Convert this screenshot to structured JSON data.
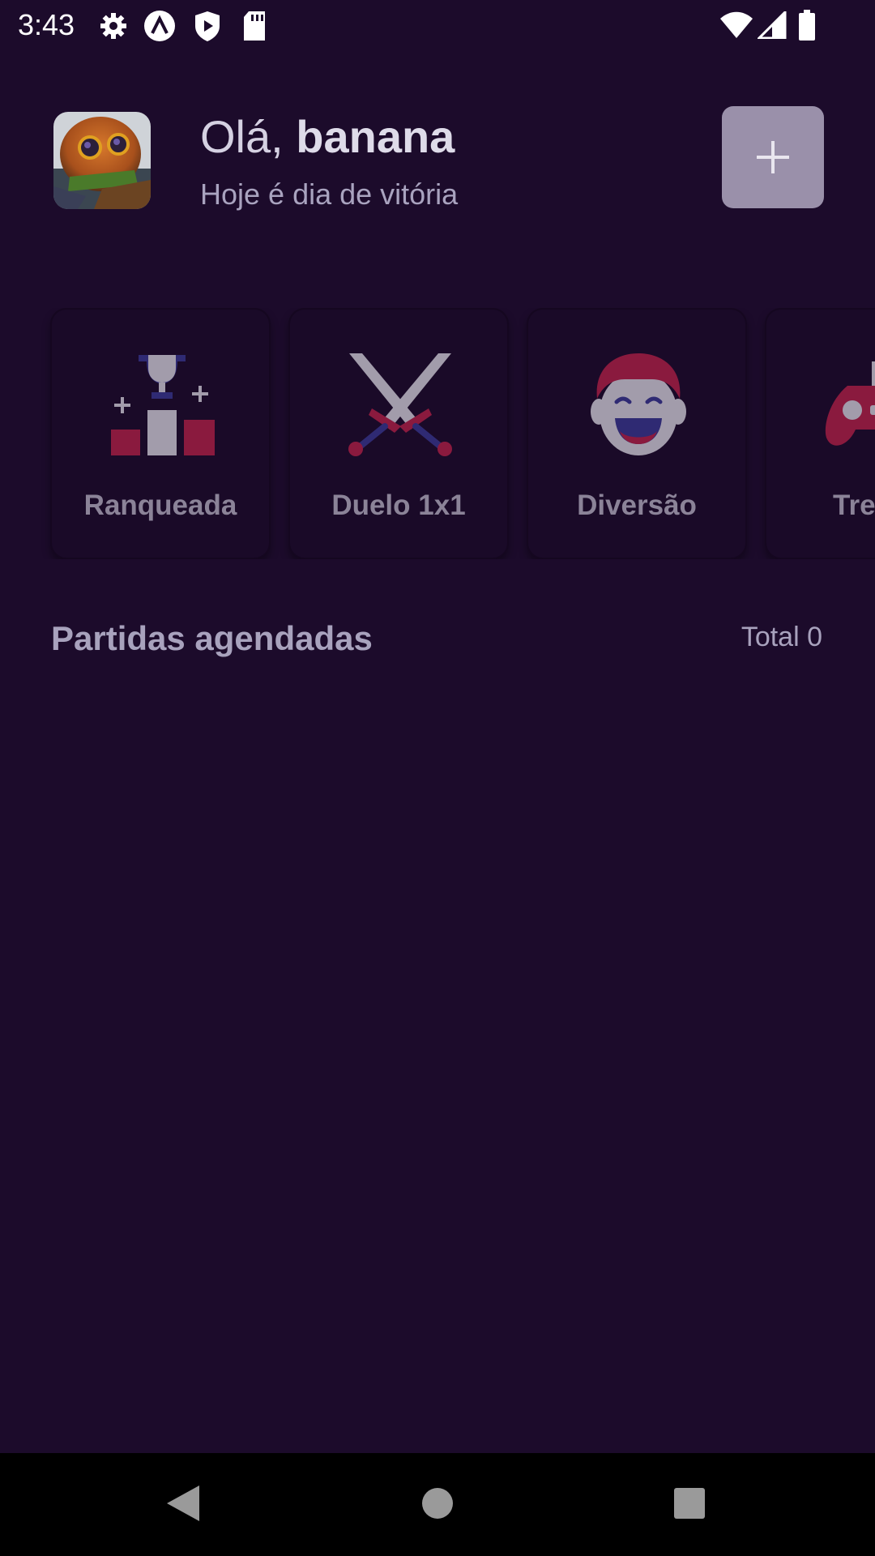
{
  "status_bar": {
    "time": "3:43",
    "icons_left": [
      "gear-icon",
      "app-a-icon",
      "play-shield-icon",
      "sd-card-icon"
    ],
    "icons_right": [
      "wifi-icon",
      "signal-icon",
      "battery-icon"
    ]
  },
  "header": {
    "greeting_prefix": "Olá, ",
    "user_name": "banana",
    "subtitle": "Hoje é dia de vitória",
    "add_label": "+"
  },
  "modes": [
    {
      "label": "Ranqueada",
      "icon": "podium-trophy-icon"
    },
    {
      "label": "Duelo 1x1",
      "icon": "crossed-swords-icon"
    },
    {
      "label": "Diversão",
      "icon": "laughing-face-icon"
    },
    {
      "label": "Tre",
      "icon": "gamepad-icon"
    }
  ],
  "scheduled": {
    "title": "Partidas agendadas",
    "total_label": "Total 0"
  },
  "colors": {
    "background": "#1c0b2b",
    "accent_red": "#8a1a3e",
    "accent_blue": "#2f2a73",
    "icon_grey": "#a29cab"
  }
}
